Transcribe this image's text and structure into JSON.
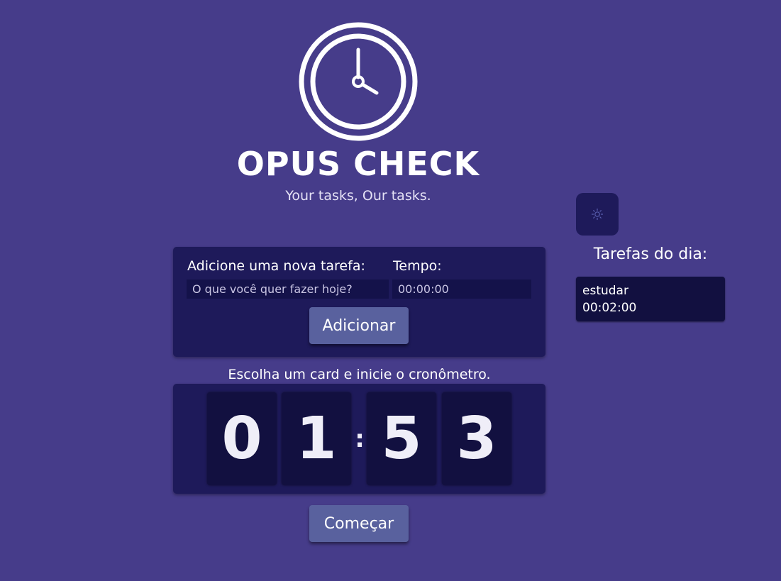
{
  "brand": {
    "title": "OPUS CHECK",
    "subtitle": "Your tasks, Our tasks."
  },
  "add_task": {
    "task_label": "Adicione uma nova tarefa:",
    "time_label": "Tempo:",
    "task_placeholder": "O que você quer fazer hoje?",
    "time_placeholder": "00:00:00",
    "add_button": "Adicionar"
  },
  "timer": {
    "instruction": "Escolha um card e inicie o cronômetro.",
    "digits": [
      "0",
      "1",
      "5",
      "3"
    ],
    "separator": ":",
    "start_button": "Começar"
  },
  "sidebar": {
    "theme_icon": "sun-icon",
    "title": "Tarefas do dia:",
    "tasks": [
      {
        "name": "estudar",
        "time": "00:02:00"
      }
    ]
  },
  "colors": {
    "background": "#463c8a",
    "card": "#1e1a5a",
    "digit_bg": "#121040",
    "button": "#59619e"
  }
}
